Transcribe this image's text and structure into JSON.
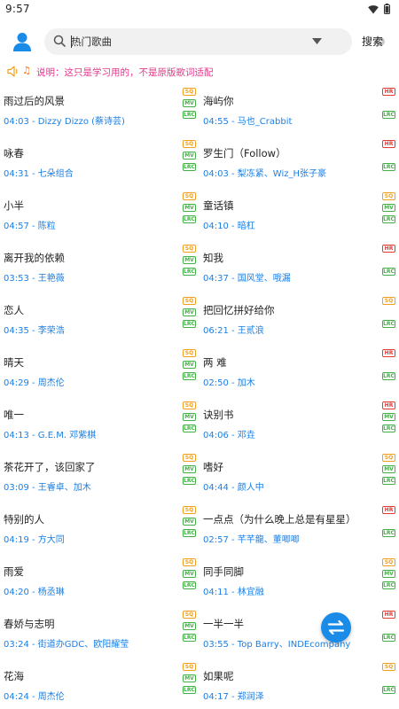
{
  "status": {
    "time": "9:57"
  },
  "search": {
    "value": "热门歌曲",
    "button_label": "搜索"
  },
  "notice": {
    "note_glyph": "♫",
    "text": "说明：这只是学习用的，不是原版歌词适配"
  },
  "colors": {
    "accent": "#1a7fe5",
    "notice_text": "#e4398c",
    "sq": "#f0a020",
    "hr": "#e53935",
    "mv": "#43b047"
  },
  "songs": [
    {
      "title": "雨过后的风景",
      "duration": "04:03",
      "artist": "Dizzy Dizzo (蔡诗芸)",
      "badges": [
        "SQ",
        "MV",
        "LRC"
      ]
    },
    {
      "title": "海屿你",
      "duration": "04:55",
      "artist": "马也_Crabbit",
      "badges": [
        "HR",
        "",
        "LRC"
      ]
    },
    {
      "title": "咏春",
      "duration": "04:31",
      "artist": "七朵组合",
      "badges": [
        "SQ",
        "MV",
        "LRC"
      ]
    },
    {
      "title": "罗生门（Follow）",
      "duration": "04:03",
      "artist": "梨冻紧、Wiz_H张子豪",
      "badges": [
        "HR",
        "",
        "LRC"
      ]
    },
    {
      "title": "小半",
      "duration": "04:57",
      "artist": "陈粒",
      "badges": [
        "SQ",
        "MV",
        "LRC"
      ]
    },
    {
      "title": "童话镇",
      "duration": "04:10",
      "artist": "暗杠",
      "badges": [
        "SQ",
        "MV",
        "LRC"
      ]
    },
    {
      "title": "离开我的依赖",
      "duration": "03:53",
      "artist": "王艳薇",
      "badges": [
        "SQ",
        "MV",
        "LRC"
      ]
    },
    {
      "title": "知我",
      "duration": "04:37",
      "artist": "国风堂、哦漏",
      "badges": [
        "HR",
        "",
        "LRC"
      ]
    },
    {
      "title": "恋人",
      "duration": "04:35",
      "artist": "李荣浩",
      "badges": [
        "SQ",
        "MV",
        "LRC"
      ]
    },
    {
      "title": "把回忆拼好给你",
      "duration": "06:21",
      "artist": "王贰浪",
      "badges": [
        "SQ",
        "",
        "LRC"
      ]
    },
    {
      "title": "晴天",
      "duration": "04:29",
      "artist": "周杰伦",
      "badges": [
        "SQ",
        "MV",
        "LRC"
      ]
    },
    {
      "title": "两 难",
      "duration": "02:50",
      "artist": "加木",
      "badges": [
        "HR",
        "",
        "LRC"
      ]
    },
    {
      "title": "唯一",
      "duration": "04:13",
      "artist": "G.E.M. 邓紫棋",
      "badges": [
        "SQ",
        "MV",
        "LRC"
      ]
    },
    {
      "title": "诀别书",
      "duration": "04:06",
      "artist": "邓垚",
      "badges": [
        "HR",
        "MV",
        "LRC"
      ]
    },
    {
      "title": "茶花开了，该回家了",
      "duration": "03:09",
      "artist": "王睿卓、加木",
      "badges": [
        "SQ",
        "MV",
        "LRC"
      ]
    },
    {
      "title": "嗜好",
      "duration": "04:44",
      "artist": "颜人中",
      "badges": [
        "SQ",
        "MV",
        "LRC"
      ]
    },
    {
      "title": "特别的人",
      "duration": "04:19",
      "artist": "方大同",
      "badges": [
        "SQ",
        "MV",
        "LRC"
      ]
    },
    {
      "title": "一点点（为什么晚上总是有星星）",
      "duration": "02:57",
      "artist": "芊芊龍、董唧唧",
      "badges": [
        "HR",
        "",
        "LRC"
      ]
    },
    {
      "title": "雨爱",
      "duration": "04:20",
      "artist": "杨丞琳",
      "badges": [
        "SQ",
        "MV",
        "LRC"
      ]
    },
    {
      "title": "同手同脚",
      "duration": "04:11",
      "artist": "林宜融",
      "badges": [
        "SQ",
        "MV",
        "LRC"
      ]
    },
    {
      "title": "春娇与志明",
      "duration": "03:24",
      "artist": "街道办GDC、欧阳耀莹",
      "badges": [
        "SQ",
        "MV",
        "LRC"
      ]
    },
    {
      "title": "一半一半",
      "duration": "03:55",
      "artist": "Top Barry、INDEcompany",
      "badges": [
        "HR",
        "",
        "LRC"
      ]
    },
    {
      "title": "花海",
      "duration": "04:24",
      "artist": "周杰伦",
      "badges": [
        "SQ",
        "MV",
        "LRC"
      ]
    },
    {
      "title": "如果呢",
      "duration": "04:17",
      "artist": "郑润泽",
      "badges": [
        "SQ",
        "",
        "LRC"
      ]
    }
  ]
}
